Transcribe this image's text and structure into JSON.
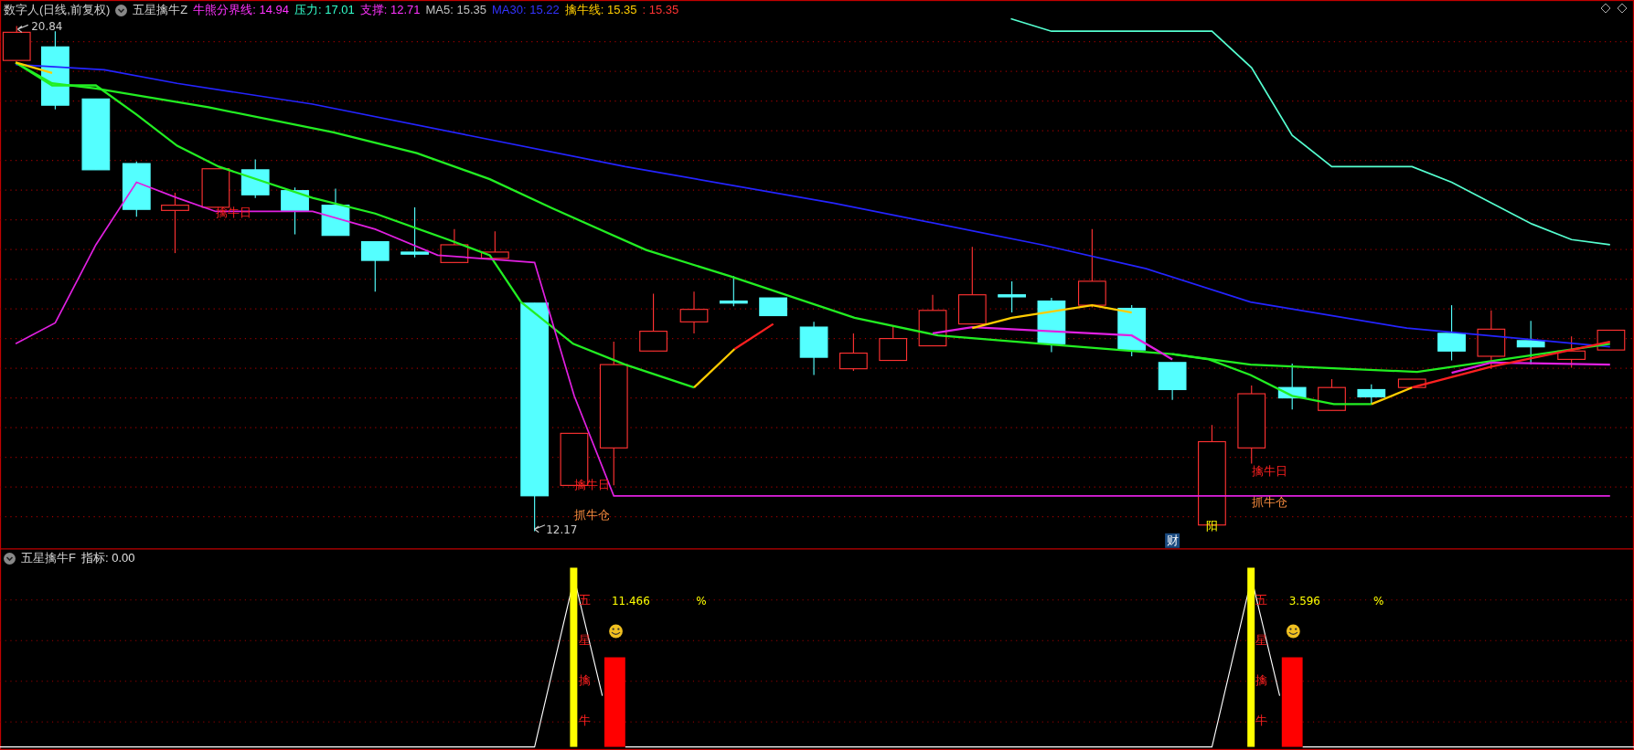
{
  "header": {
    "title": "数字人(日线,前复权)",
    "indicator": "五星擒牛Z",
    "legend": [
      {
        "text": "牛熊分界线: 14.94",
        "color": "#ff33ff"
      },
      {
        "text": "压力: 17.01",
        "color": "#33ffcc"
      },
      {
        "text": "支撑: 12.71",
        "color": "#ff33ff"
      },
      {
        "text": "MA5: 15.35",
        "color": "#c0c0c0"
      },
      {
        "text": "MA30: 15.22",
        "color": "#3333ff"
      },
      {
        "text": "擒牛线: 15.35",
        "color": "#ffcc00"
      },
      {
        "text": ": 15.35",
        "color": "#ff3333"
      }
    ]
  },
  "price_marks": [
    {
      "kind": "high",
      "text": "20.84"
    },
    {
      "kind": "low",
      "text": "12.17"
    }
  ],
  "signals": [
    {
      "kind": "buy",
      "text": "擒牛日"
    },
    {
      "kind": "buy",
      "text": "擒牛日"
    },
    {
      "kind": "position",
      "text": "抓牛仓"
    },
    {
      "kind": "tag",
      "text": "财"
    },
    {
      "kind": "yang",
      "text": "阳"
    },
    {
      "kind": "buy",
      "text": "擒牛日"
    },
    {
      "kind": "position",
      "text": "抓牛仓"
    }
  ],
  "sub_panel": {
    "title": "五星擒牛F",
    "indicator": "指标: 0.00",
    "signals": [
      {
        "value": "11.466",
        "unit": "%",
        "chars": [
          "五",
          "星",
          "擒",
          "牛"
        ]
      },
      {
        "value": "3.596",
        "unit": "%",
        "chars": [
          "五",
          "星",
          "擒",
          "牛"
        ]
      }
    ]
  }
}
